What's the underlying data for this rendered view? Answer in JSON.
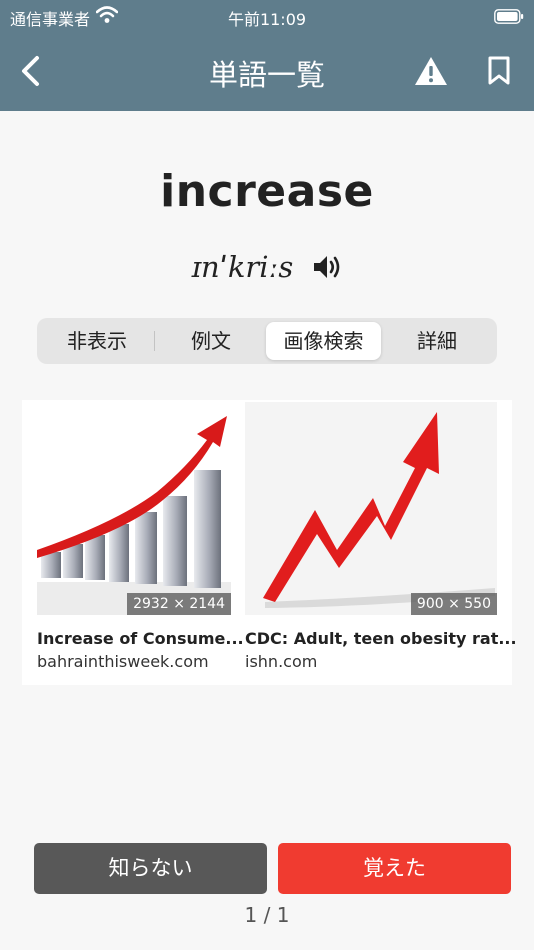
{
  "status_bar": {
    "carrier": "通信事業者",
    "time": "午前11:09"
  },
  "nav": {
    "title": "単語一覧"
  },
  "word": {
    "text": "increase",
    "pronunciation": "ɪnˈkriːs"
  },
  "tabs": [
    {
      "label": "非表示",
      "active": false
    },
    {
      "label": "例文",
      "active": false
    },
    {
      "label": "画像検索",
      "active": true
    },
    {
      "label": "詳細",
      "active": false
    }
  ],
  "results": [
    {
      "title": "Increase of Consume...",
      "source": "bahrainthisweek.com",
      "dimensions": "2932 × 2144"
    },
    {
      "title": "CDC: Adult, teen obesity rat...",
      "source": "ishn.com",
      "dimensions": "900 × 550"
    }
  ],
  "buttons": {
    "dont_know": "知らない",
    "know": "覚えた"
  },
  "pagination": "1 / 1",
  "colors": {
    "header": "#5f7d8c",
    "dont_know": "#585858",
    "know": "#f03b30"
  }
}
